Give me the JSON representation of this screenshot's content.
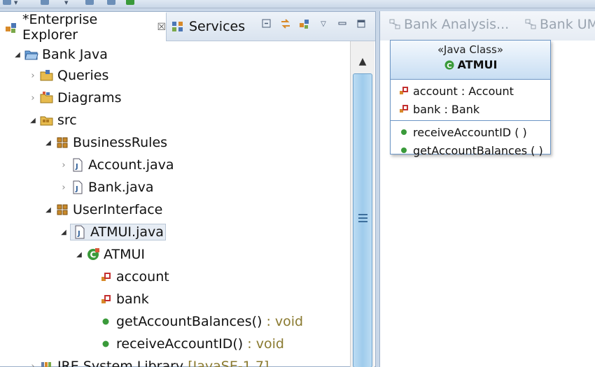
{
  "explorer": {
    "active_tab_label": "*Enterprise Explorer",
    "active_tab_close": "☒",
    "inactive_tab_label": "Services",
    "tree": [
      {
        "label": "Bank Java",
        "suffix": ""
      },
      {
        "label": "Queries",
        "suffix": ""
      },
      {
        "label": "Diagrams",
        "suffix": ""
      },
      {
        "label": "src",
        "suffix": ""
      },
      {
        "label": "BusinessRules",
        "suffix": ""
      },
      {
        "label": "Account.java",
        "suffix": ""
      },
      {
        "label": "Bank.java",
        "suffix": ""
      },
      {
        "label": "UserInterface",
        "suffix": ""
      },
      {
        "label": "ATMUI.java",
        "suffix": ""
      },
      {
        "label": "ATMUI",
        "suffix": ""
      },
      {
        "label": "account",
        "suffix": ""
      },
      {
        "label": "bank",
        "suffix": ""
      },
      {
        "label": "getAccountBalances()",
        "suffix": " : void"
      },
      {
        "label": "receiveAccountID()",
        "suffix": " : void"
      },
      {
        "label": "JRE System Library",
        "suffix": " [JavaSE-1.7]"
      }
    ]
  },
  "editor": {
    "tabs": [
      "Bank Analysis...",
      "Bank UM"
    ],
    "uml": {
      "stereotype": "«Java Class»",
      "class_name": "ATMUI",
      "attributes": [
        {
          "name": "account : Account"
        },
        {
          "name": "bank : Bank"
        }
      ],
      "operations": [
        {
          "name": "receiveAccountID ( )"
        },
        {
          "name": "getAccountBalances ( )"
        }
      ]
    }
  },
  "colors": {
    "selection": "#e6ecf4",
    "scroll_thumb": "#9fcbec",
    "uml_border": "#6c95c4",
    "method_green": "#3a9a3a",
    "field_red": "#c43030",
    "return_type": "#8a7a30"
  },
  "icons": {
    "project": "project-folder-icon",
    "queries": "queries-folder-icon",
    "diagrams": "diagrams-folder-icon",
    "src": "source-folder-icon",
    "package": "package-icon",
    "java_file": "java-file-icon",
    "class": "class-icon",
    "field": "private-field-icon",
    "method": "public-method-icon",
    "library": "library-icon"
  }
}
